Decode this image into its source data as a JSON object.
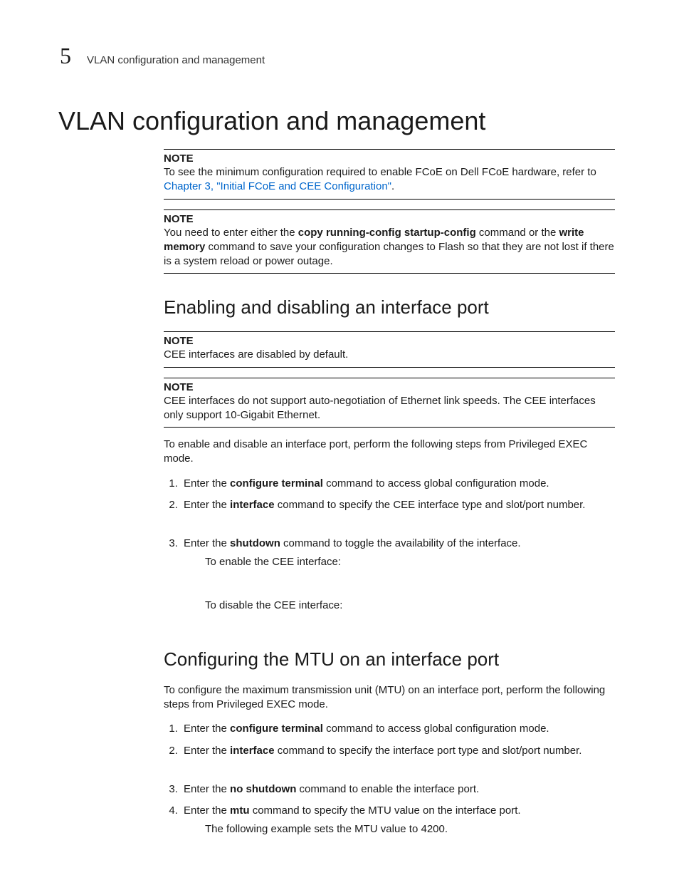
{
  "header": {
    "chapter_number": "5",
    "running_title": "VLAN configuration and management"
  },
  "title": "VLAN configuration and management",
  "note1": {
    "label": "NOTE",
    "prefix": "To see the minimum configuration required to enable FCoE on Dell FCoE hardware, refer to ",
    "link": "Chapter 3, \"Initial FCoE and CEE Configuration\"",
    "suffix": "."
  },
  "note2": {
    "label": "NOTE",
    "p1a": "You need to enter either the ",
    "cmd1": "copy running-config startup-config",
    "p1b": " command or the ",
    "cmd2": "write memory",
    "p1c": " command to save your configuration changes to Flash so that they are not lost if there is a system reload or power outage."
  },
  "section1": {
    "title": "Enabling and disabling an interface port",
    "note3": {
      "label": "NOTE",
      "body": "CEE interfaces are disabled by default."
    },
    "note4": {
      "label": "NOTE",
      "body": "CEE interfaces do not support auto-negotiation of Ethernet link speeds. The CEE interfaces only support 10-Gigabit Ethernet."
    },
    "intro": "To enable and disable an interface port, perform the following steps from Privileged EXEC mode.",
    "steps": {
      "s1a": "Enter the ",
      "s1cmd": "configure terminal",
      "s1b": " command to access global configuration mode.",
      "s2a": "Enter the ",
      "s2cmd": "interface",
      "s2b": " command to specify the CEE interface type and slot/port number.",
      "s3a": "Enter the ",
      "s3cmd": "shutdown",
      "s3b": " command to toggle the availability of the interface.",
      "s3_enable": "To enable the CEE interface:",
      "s3_disable": "To disable the CEE interface:"
    }
  },
  "section2": {
    "title": "Configuring the MTU on an interface port",
    "intro": "To configure the maximum transmission unit (MTU) on an interface port, perform the following steps from Privileged EXEC mode.",
    "steps": {
      "s1a": "Enter the ",
      "s1cmd": "configure terminal",
      "s1b": " command to access global configuration mode.",
      "s2a": "Enter the ",
      "s2cmd": "interface",
      "s2b": " command to specify the interface port type and slot/port number.",
      "s3a": "Enter the ",
      "s3cmd": "no shutdown",
      "s3b": " command to enable the interface port.",
      "s4a": "Enter the ",
      "s4cmd": "mtu",
      "s4b": " command to specify the MTU value on the interface port.",
      "s4_sub": "The following example sets the MTU value to 4200."
    }
  }
}
